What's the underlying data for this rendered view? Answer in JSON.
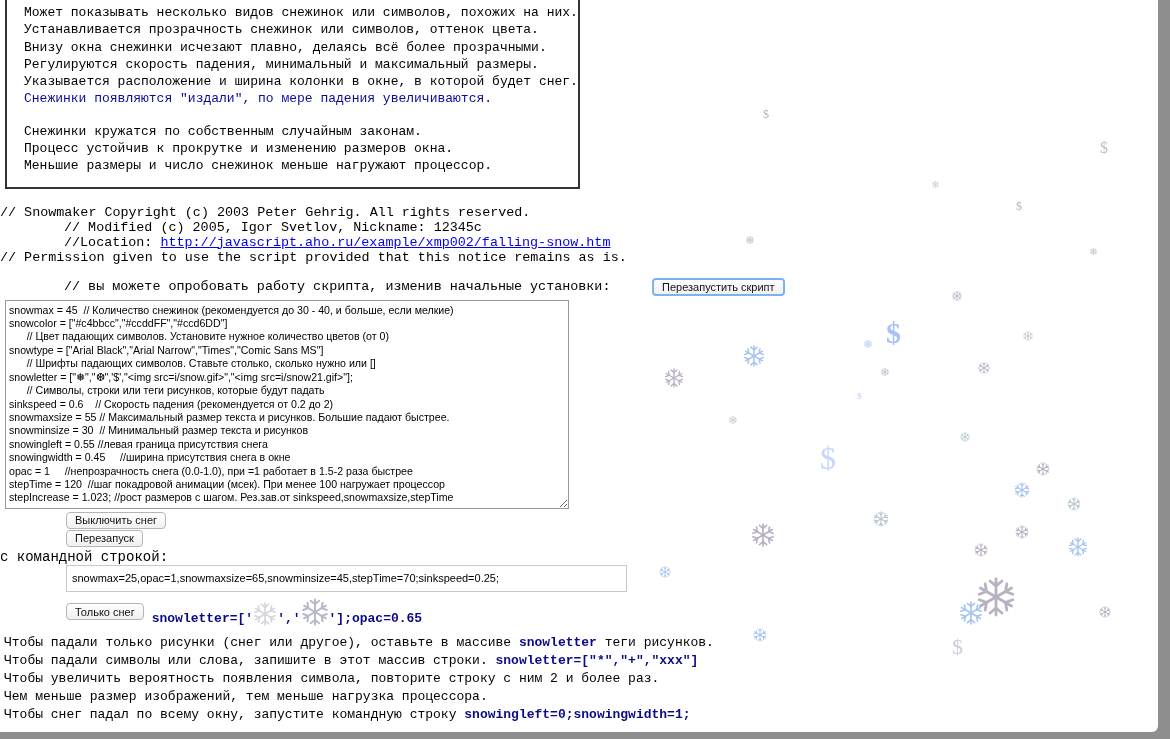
{
  "description_box": {
    "paragraphs": [
      {
        "lines": [
          {
            "text": "Может показывать несколько видов снежинок или символов, похожих на них.",
            "kind": "normal"
          },
          {
            "text": "Устанавливается прозрачность снежинок или символов, оттенок цвета.",
            "kind": "normal"
          },
          {
            "text": "Внизу окна снежинки исчезают плавно, делаясь всё более прозрачными.",
            "kind": "normal"
          },
          {
            "text": "Регулируются скорость падения, минимальный и максимальный размеры.",
            "kind": "normal"
          },
          {
            "text": "Указывается расположение и ширина колонки в окне, в которой будет снег.",
            "kind": "normal"
          },
          {
            "text": "Снежинки появляются \"издали\", по мере падения увеличиваются.",
            "kind": "highlight"
          }
        ]
      },
      {
        "lines": [
          {
            "text": "Снежинки кружатся по собственным случайным законам.",
            "kind": "normal"
          },
          {
            "text": "Процесс устойчив к прокрутке и изменению размеров окна.",
            "kind": "normal"
          },
          {
            "text": "Меньшие размеры и число снежинок меньше нагружают процессор.",
            "kind": "normal"
          }
        ]
      }
    ]
  },
  "copyright": [
    {
      "text": "// Snowmaker Copyright (c) 2003 Peter Gehrig. All rights reserved.",
      "kind": "plain"
    },
    {
      "text": "// Modified (c) 2005, Igor Svetlov, Nickname: 12345c",
      "kind": "indented"
    },
    {
      "text": "//Location: ",
      "link": "http://javascript.aho.ru/example/xmp002/falling-snow.htm",
      "kind": "indented"
    },
    {
      "text": "// Permission given to use the script provided that this notice remains as is.",
      "kind": "plain"
    }
  ],
  "settings_prompt": "// вы можете опробовать работу скрипта, изменив начальные установки:",
  "restart_script_button": "Перезапустить скрипт",
  "settings_textarea": {
    "value": "snowmax = 45  // Количество снежинок (рекомендуется до 30 - 40, и больше, если мелкие)\nsnowcolor = [\"#c4bbcc\",\"#ccddFF\",\"#ccd6DD\"]\n\t// Цвет падающих символов. Установите нужное количество цветов (от 0)\nsnowtype = [\"Arial Black\",\"Arial Narrow\",\"Times\",\"Comic Sans MS\"]\n\t// Шрифты падающих символов. Ставьте столько, сколько нужно или []\nsnowletter = [\"❅\",\"❆\",'$',\"<img src=i/snow.gif>\",\"<img src=i/snow21.gif>\"];\n\t// Символы, строки или теги рисунков, которые будут падать\nsinkspeed = 0.6    // Скорость падения (рекомендуется от 0.2 до 2)\nsnowmaxsize = 55 // Максимальный размер текста и рисунков. Большие падают быстрее.\nsnowminsize = 30  // Минимальный размер текста и рисунков\nsnowingleft = 0.55 //левая граница присутствия снега\nsnowingwidth = 0.45     //ширина присутствия снега в окне\nopac = 1     //непрозрачность снега (0.0-1.0), при =1 работает в 1.5-2 раза быстрее\nstepTime = 120  //шаг покадровой анимации (мсек). При менее 100 нагружает процессор\nstepIncrease = 1.023; //рост размеров с шагом. Рез.зав.от sinkspeed,snowmaxsize,stepTime"
  },
  "buttons": [
    "Выключить снег",
    "Перезапуск"
  ],
  "command_label": "с командной строкой:",
  "command_field": {
    "value": "snowmax=25,opac=1,snowmaxsize=65,snowminsize=45,stepTime=70;sinkspeed=0.25;"
  },
  "snow_only_button": "Только снег",
  "snow_only_code": {
    "prefix": "snowletter=['",
    "separator": "','",
    "suffix": "'];opac=0.65"
  },
  "notes": [
    [
      {
        "kind": "text",
        "text": "Чтобы падали только рисунки (снег или другое), оставьте в массиве "
      },
      {
        "kind": "code",
        "text": "snowletter"
      },
      {
        "kind": "text",
        "text": " теги рисунков."
      }
    ],
    [
      {
        "kind": "text",
        "text": "Чтобы падали символы или слова, запишите в этот массив строки.  "
      },
      {
        "kind": "code",
        "text": "snowletter=[\"*\",\"+\",\"xxx\"]"
      }
    ],
    [
      {
        "kind": "text",
        "text": "Чтобы увеличить вероятность появления символа, повторите строку с ним 2 и более раз."
      }
    ],
    [
      {
        "kind": "text",
        "text": "Чем меньше размер изображений, тем меньше нагрузка процессора."
      }
    ],
    [
      {
        "kind": "text",
        "text": "Чтобы снег падал по всему окну, запустите командную строку  "
      },
      {
        "kind": "code",
        "text": "snowingleft=0;snowingwidth=1;"
      }
    ]
  ],
  "falling_symbols": [
    "$",
    "$",
    "$",
    "$",
    "$",
    "$",
    "$"
  ]
}
